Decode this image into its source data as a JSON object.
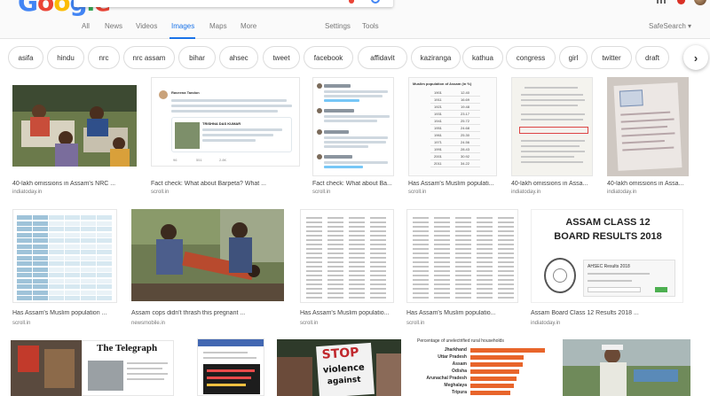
{
  "header": {
    "logo_letters": [
      "G",
      "o",
      "o",
      "g",
      "l",
      "e"
    ],
    "search_query": ""
  },
  "tabs": [
    {
      "label": "All",
      "active": false
    },
    {
      "label": "News",
      "active": false
    },
    {
      "label": "Videos",
      "active": false
    },
    {
      "label": "Images",
      "active": true
    },
    {
      "label": "Maps",
      "active": false
    },
    {
      "label": "More",
      "active": false
    },
    {
      "label": "Settings",
      "active": false
    },
    {
      "label": "Tools",
      "active": false
    },
    {
      "label": "SafeSearch ▾",
      "active": false
    }
  ],
  "chips": [
    "asifa",
    "hindu",
    "nrc",
    "nrc assam",
    "bihar",
    "ahsec",
    "tweet",
    "facebook",
    "affidavit",
    "kaziranga",
    "kathua",
    "congress",
    "girl",
    "twitter",
    "draft"
  ],
  "results": [
    {
      "caption": "40-lakh omissions in Assam's NRC ...",
      "source": "indiatoday.in"
    },
    {
      "caption": "Fact check: What about Barpeta? What ...",
      "source": "scroll.in"
    },
    {
      "caption": "Fact check: What about Ba...",
      "source": "scroll.in"
    },
    {
      "caption": "Has Assam's Muslim populati...",
      "source": "scroll.in"
    },
    {
      "caption": "40-lakh omissions in Assa...",
      "source": "indiatoday.in"
    },
    {
      "caption": "40-lakh omissions in Assa...",
      "source": "indiatoday.in"
    },
    {
      "caption": "Has Assam's Muslim population ...",
      "source": "scroll.in"
    },
    {
      "caption": "Assam cops didn't thrash this pregnant ...",
      "source": "newsmobile.in"
    },
    {
      "caption": "Has Assam's Muslim populatio...",
      "source": "scroll.in"
    },
    {
      "caption": "Has Assam's Muslim populatio...",
      "source": "scroll.in"
    },
    {
      "caption": "Assam Board Class 12 Results 2018 ...",
      "source": "indiatoday.in"
    }
  ],
  "thumb_text": {
    "tweet_author": "Raveena Tandon",
    "tweet_quoted": "TRISHNA DAS KUMAR",
    "tweet_counts": [
      "96",
      "551",
      "2.8K"
    ],
    "muslim_table_title": "Muslim population of Assam (in %)",
    "muslim_table_years": [
      "1901",
      "1911",
      "1921",
      "1931",
      "1941",
      "1951",
      "1961",
      "1971",
      "1991",
      "2001",
      "2011"
    ],
    "muslim_table_values": [
      "12.40",
      "16.69",
      "19.48",
      "23.17",
      "25.72",
      "24.68",
      "25.30",
      "24.56",
      "28.43",
      "30.92",
      "34.22"
    ],
    "ahsec_heading_1": "ASSAM CLASS 12",
    "ahsec_heading_2": "BOARD RESULTS 2018",
    "ahsec_card_title": "AHSEC Results 2018",
    "telegraph": "The Telegraph",
    "protest_sign": [
      "STOP",
      "violence",
      "against"
    ],
    "bar_title": "Percentage of unelectrified rural households",
    "bar_states": [
      "Jharkhand",
      "Uttar Pradesh",
      "Assam",
      "Odisha",
      "Arunachal Pradesh",
      "Meghalaya",
      "Tripura"
    ]
  },
  "colors": {
    "accent": "#1a73e8",
    "bar": "#e8652b"
  }
}
